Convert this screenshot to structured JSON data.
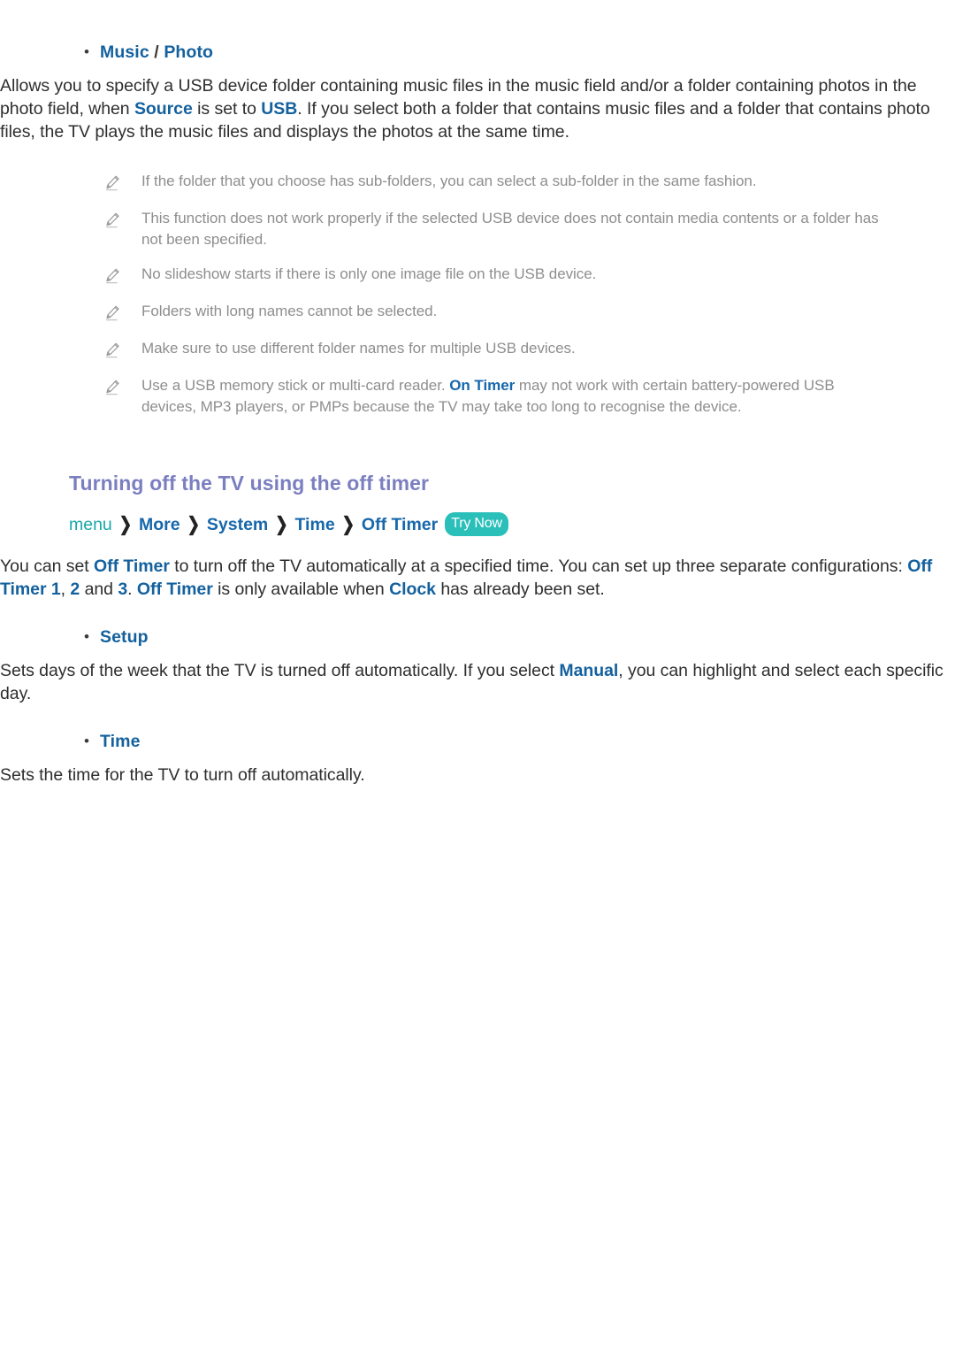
{
  "page": {
    "colors": {
      "keyword_blue": "#14619e",
      "heading_purple": "#7b7fc0",
      "note_gray": "#8e8e8e",
      "badge_teal": "#2bbfba",
      "crumb_teal": "#18a7a8",
      "body_text": "#2e2e2e"
    }
  },
  "music_photo_section": {
    "bullet_marker": "•",
    "label_part1": "Music",
    "label_separator": " / ",
    "label_part2": "Photo",
    "paragraph": {
      "t1": "Allows you to specify a USB device folder containing music files in the music field and/or a folder containing photos in the photo field, when ",
      "kw1": "Source",
      "t2": " is set to ",
      "kw2": "USB",
      "t3": ". If you select both a folder that contains music files and a folder that contains photo files, the TV plays the music files and displays the photos at the same time."
    },
    "notes": [
      {
        "icon": "pencil-note-icon",
        "text": "If the folder that you choose has sub-folders, you can select a sub-folder in the same fashion."
      },
      {
        "icon": "pencil-note-icon",
        "text": "This function does not work properly if the selected USB device does not contain media contents or a folder has not been specified."
      },
      {
        "icon": "pencil-note-icon",
        "text": "No slideshow starts if there is only one image file on the USB device."
      },
      {
        "icon": "pencil-note-icon",
        "text": "Folders with long names cannot be selected."
      },
      {
        "icon": "pencil-note-icon",
        "text": "Make sure to use different folder names for multiple USB devices."
      }
    ],
    "last_note": {
      "icon": "pencil-note-icon",
      "t1": "Use a USB memory stick or multi-card reader. ",
      "kw1": "On Timer",
      "t2": " may not work with certain battery-powered USB devices, MP3 players, or PMPs because the TV may take too long to recognise the device."
    }
  },
  "off_timer_section": {
    "heading": "Turning off the TV using the off timer",
    "breadcrumb": {
      "items": [
        "menu",
        "More",
        "System",
        "Time",
        "Off Timer"
      ],
      "chevron": "❯",
      "badge": "Try Now"
    },
    "paragraph": {
      "t1": "You can set ",
      "kw1": "Off Timer",
      "t2": " to turn off the TV automatically at a specified time. You can set up three separate configurations: ",
      "kw2": "Off Timer 1",
      "t3": ", ",
      "kw3": "2",
      "t4": " and ",
      "kw4": "3",
      "t5": ". ",
      "kw5": "Off Timer",
      "t6": " is only available when ",
      "kw6": "Clock",
      "t7": " has already been set."
    },
    "sub_items": [
      {
        "bullet_marker": "•",
        "label": "Setup",
        "body": {
          "t1": "Sets days of the week that the TV is turned off automatically. If you select ",
          "kw1": "Manual",
          "t2": ", you can highlight and select each specific day."
        }
      },
      {
        "bullet_marker": "•",
        "label": "Time",
        "body": {
          "t1": "Sets the time for the TV to turn off automatically.",
          "kw1": "",
          "t2": ""
        }
      }
    ]
  }
}
